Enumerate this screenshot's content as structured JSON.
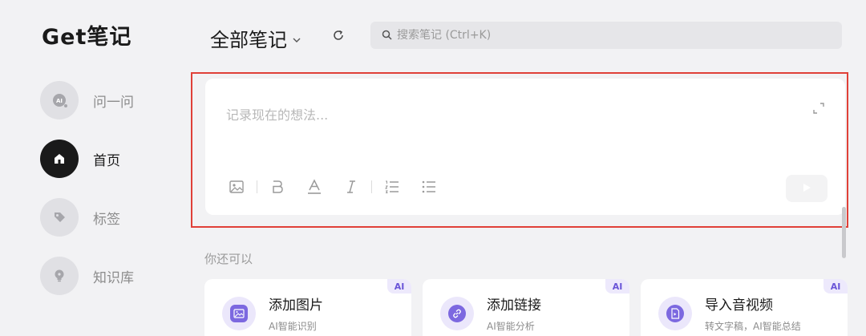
{
  "app": {
    "logo": "Get笔记"
  },
  "sidebar": {
    "items": [
      {
        "label": "问一问",
        "icon": "ai-icon"
      },
      {
        "label": "首页",
        "icon": "home-icon",
        "active": true
      },
      {
        "label": "标签",
        "icon": "tag-icon"
      },
      {
        "label": "知识库",
        "icon": "bulb-icon"
      }
    ]
  },
  "header": {
    "title": "全部笔记",
    "search_placeholder": "搜索笔记 (Ctrl+K)"
  },
  "editor": {
    "placeholder": "记录现在的想法...",
    "toolbar": [
      "image-icon",
      "bold-icon",
      "text-color-icon",
      "italic-icon",
      "ordered-list-icon",
      "bullet-list-icon"
    ]
  },
  "suggestions": {
    "title": "你还可以",
    "cards": [
      {
        "title": "添加图片",
        "subtitle": "AI智能识别",
        "badge": "AI",
        "icon": "picture-icon"
      },
      {
        "title": "添加链接",
        "subtitle": "AI智能分析",
        "badge": "AI",
        "icon": "link-icon"
      },
      {
        "title": "导入音视频",
        "subtitle": "转文字稿，AI智能总结",
        "badge": "AI",
        "icon": "file-icon"
      }
    ]
  },
  "colors": {
    "accent": "#7c68e0",
    "highlight_border": "#e04038",
    "background": "#f2f2f4"
  }
}
